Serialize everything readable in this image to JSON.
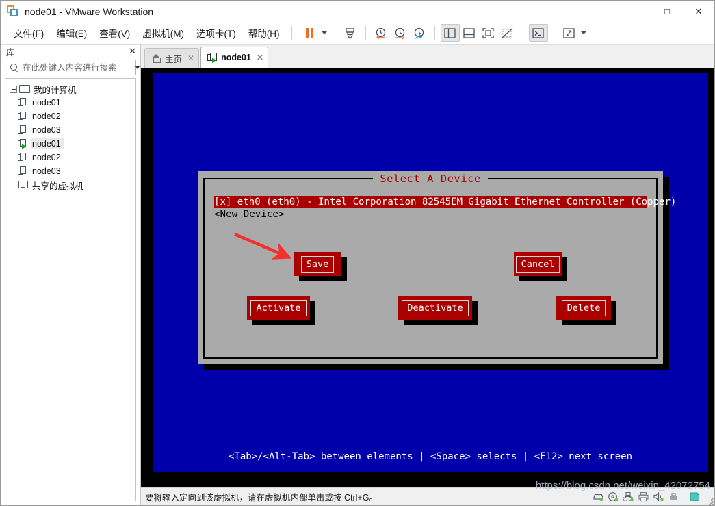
{
  "window": {
    "title": "node01 - VMware Workstation",
    "logo_icon": "vmware-logo-icon",
    "controls": {
      "minimize": "—",
      "maximize": "□",
      "close": "✕"
    }
  },
  "menubar": {
    "items": [
      {
        "label": "文件(F)",
        "name": "menu-file"
      },
      {
        "label": "编辑(E)",
        "name": "menu-edit"
      },
      {
        "label": "查看(V)",
        "name": "menu-view"
      },
      {
        "label": "虚拟机(M)",
        "name": "menu-vm"
      },
      {
        "label": "选项卡(T)",
        "name": "menu-tabs"
      },
      {
        "label": "帮助(H)",
        "name": "menu-help"
      }
    ]
  },
  "toolbar": {
    "buttons": [
      {
        "name": "suspend-button",
        "icon": "pause-icon"
      },
      {
        "name": "power-dropdown",
        "icon": "chevron-down-icon"
      },
      {
        "name": "snapshot-take-button",
        "icon": "take-snapshot-icon"
      },
      {
        "name": "snapshot-revert-button",
        "icon": "revert-snapshot-icon"
      },
      {
        "name": "snapshot-restore-button",
        "icon": "restore-snapshot-icon"
      },
      {
        "name": "snapshot-manager-button",
        "icon": "manage-snapshots-icon"
      },
      {
        "name": "show-library-button",
        "icon": "library-panel-icon"
      },
      {
        "name": "show-thumbnail-bar-button",
        "icon": "thumbnail-bar-icon"
      },
      {
        "name": "fullscreen-button",
        "icon": "fullscreen-icon"
      },
      {
        "name": "unity-mode-button",
        "icon": "unity-mode-icon"
      },
      {
        "name": "console-view-button",
        "icon": "console-icon"
      },
      {
        "name": "stretch-guest-button",
        "icon": "stretch-icon"
      },
      {
        "name": "stretch-dropdown",
        "icon": "chevron-down-icon"
      }
    ]
  },
  "sidebar": {
    "title": "库",
    "close_label": "✕",
    "search": {
      "placeholder": "在此处键入内容进行搜索",
      "value": ""
    },
    "tree": [
      {
        "label": "我的计算机",
        "icon": "monitor-icon",
        "level": 0,
        "expander": true,
        "selected": false,
        "name": "tree-item-my-computer"
      },
      {
        "label": "node01",
        "icon": "vm-icon",
        "level": 1,
        "expander": false,
        "selected": false,
        "running": false,
        "name": "tree-item-node01-a"
      },
      {
        "label": "node02",
        "icon": "vm-icon",
        "level": 1,
        "expander": false,
        "selected": false,
        "running": false,
        "name": "tree-item-node02-a"
      },
      {
        "label": "node03",
        "icon": "vm-icon",
        "level": 1,
        "expander": false,
        "selected": false,
        "running": false,
        "name": "tree-item-node03-a"
      },
      {
        "label": "node01",
        "icon": "vm-running-icon",
        "level": 1,
        "expander": false,
        "selected": true,
        "running": true,
        "name": "tree-item-node01-b"
      },
      {
        "label": "node02",
        "icon": "vm-icon",
        "level": 1,
        "expander": false,
        "selected": false,
        "running": false,
        "name": "tree-item-node02-b"
      },
      {
        "label": "node03",
        "icon": "vm-icon",
        "level": 1,
        "expander": false,
        "selected": false,
        "running": false,
        "name": "tree-item-node03-b"
      },
      {
        "label": "共享的虚拟机",
        "icon": "shared-vms-icon",
        "level": 0,
        "expander": false,
        "selected": false,
        "name": "tree-item-shared-vms"
      }
    ]
  },
  "tabs": [
    {
      "label": "主页",
      "icon": "home-icon",
      "active": false,
      "close": "✕",
      "name": "tab-home"
    },
    {
      "label": "node01",
      "icon": "vm-running-icon",
      "active": true,
      "close": "✕",
      "name": "tab-node01"
    }
  ],
  "vm_console": {
    "background_color": "#0000AA",
    "dialog": {
      "title": "Select A Device",
      "title_color": "#AA0000",
      "background_color": "#AAAAAA",
      "list": [
        {
          "text": "[x] eth0 (eth0) - Intel Corporation 82545EM Gigabit Ethernet Controller (Copper)",
          "selected": true
        },
        {
          "text": "<New Device>",
          "selected": false
        }
      ],
      "buttons": [
        {
          "label": "Save",
          "name": "tui-save-button"
        },
        {
          "label": "Cancel",
          "name": "tui-cancel-button"
        },
        {
          "label": "Activate",
          "name": "tui-activate-button"
        },
        {
          "label": "Deactivate",
          "name": "tui-deactivate-button"
        },
        {
          "label": "Delete",
          "name": "tui-delete-button"
        }
      ],
      "button_color": "#AA0000"
    },
    "help_line": "<Tab>/<Alt-Tab> between elements   |   <Space> selects   |   <F12> next screen",
    "annotation": {
      "type": "arrow",
      "color": "#f4312c",
      "points_to": "Save"
    }
  },
  "statusbar": {
    "message": "要将输入定向到该虚拟机，请在虚拟机内部单击或按 Ctrl+G。",
    "tray": [
      {
        "name": "hard-disk-icon"
      },
      {
        "name": "cd-dvd-icon"
      },
      {
        "name": "network-adapter-icon"
      },
      {
        "name": "printer-icon"
      },
      {
        "name": "sound-card-icon"
      },
      {
        "name": "usb-device-icon"
      },
      {
        "name": "display-icon"
      }
    ]
  },
  "watermark": "https://blog.csdn.net/weixin_42072754"
}
